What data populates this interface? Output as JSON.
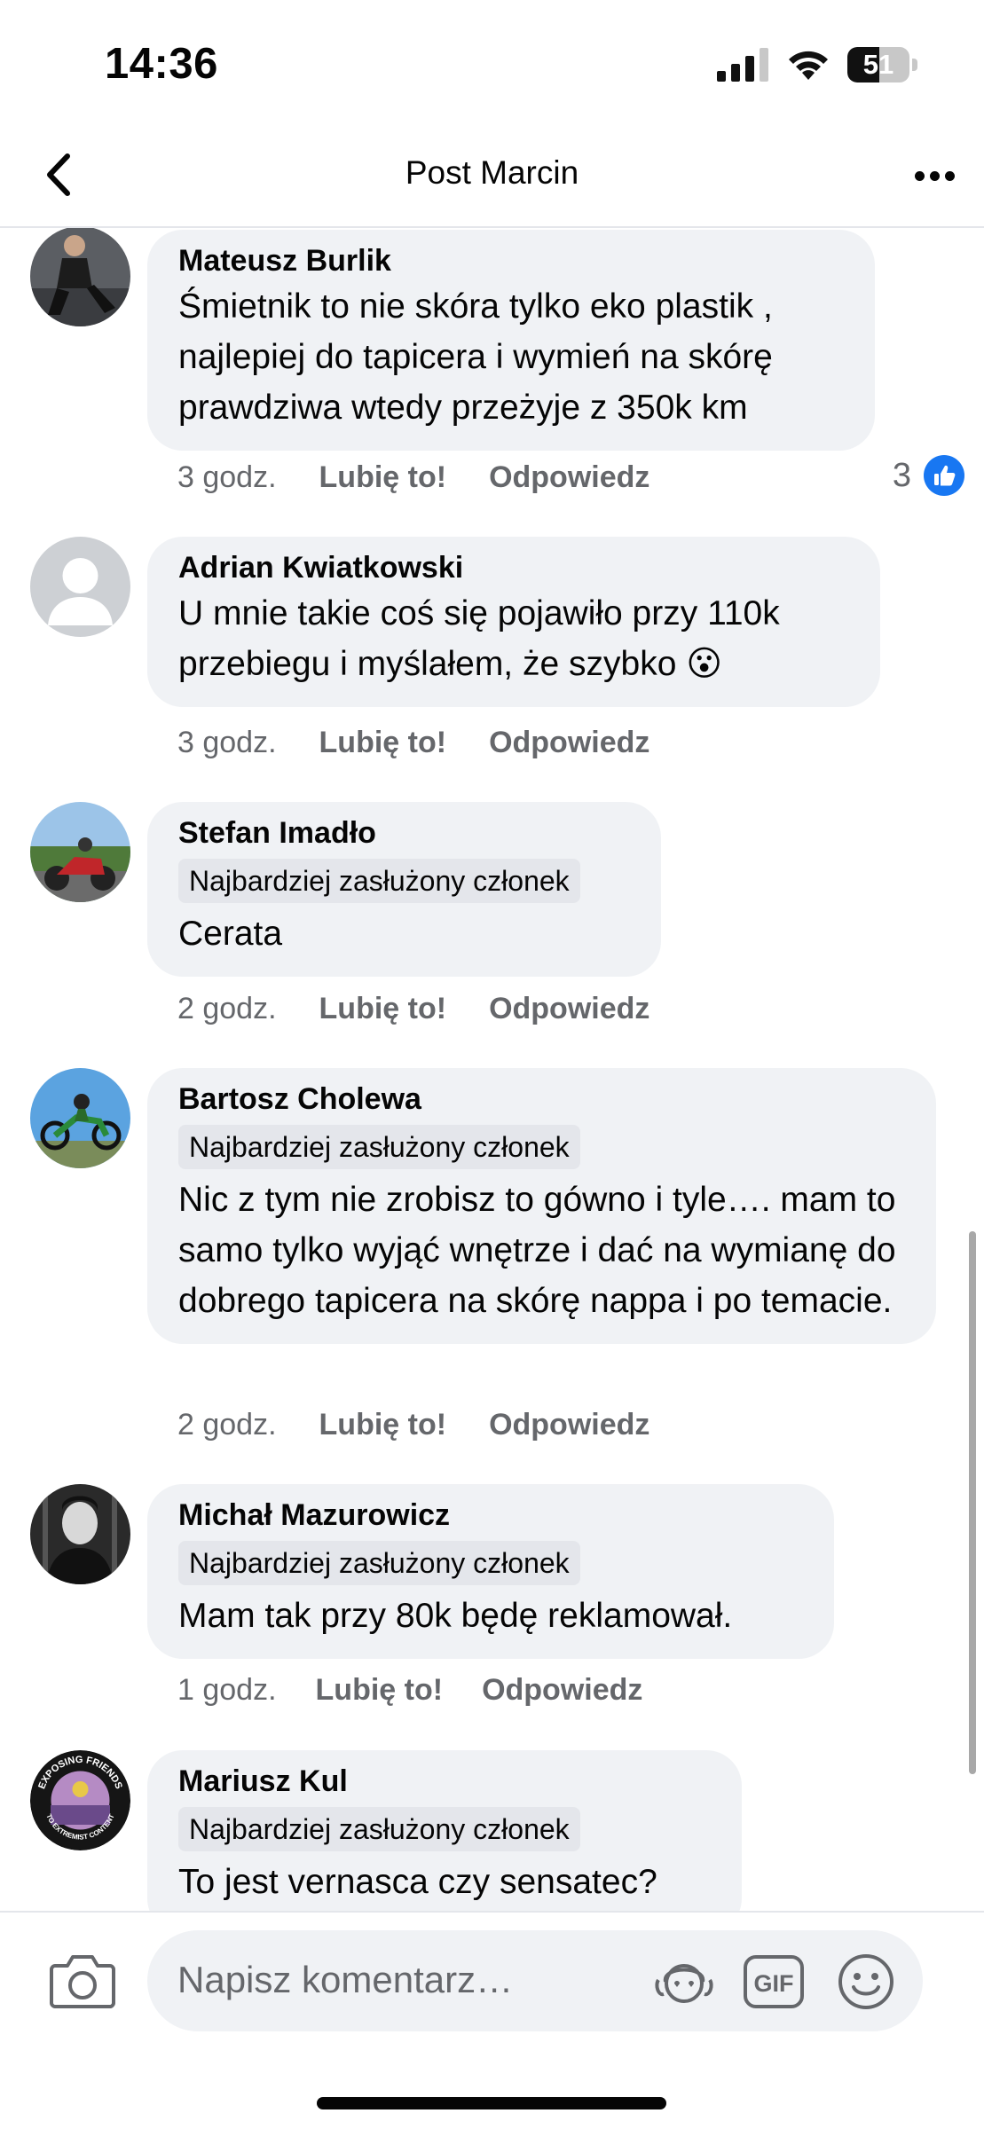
{
  "status_bar": {
    "time": "14:36",
    "battery_level": "51",
    "battery_fraction": 0.51,
    "icons": [
      "cellular-signal-icon",
      "wifi-icon",
      "battery-icon"
    ]
  },
  "header": {
    "title": "Post Marcin",
    "back_icon": "chevron-left-icon",
    "more_icon": "more-dots-icon"
  },
  "comments": [
    {
      "author": "Mateusz Burlik",
      "badge": "",
      "text": "Śmietnik to nie skóra tylko eko plastik , najlepiej do tapicera i wymień na skórę prawdziwa wtedy przeżyje z 350k km",
      "time": "3 godz.",
      "like_label": "Lubię to!",
      "reply_label": "Odpowiedz",
      "reaction_count": "3"
    },
    {
      "author": "Adrian Kwiatkowski",
      "badge": "",
      "text": "U mnie takie coś się pojawiło przy 110k przebiegu i myślałem, że szybko 😮",
      "time": "3 godz.",
      "like_label": "Lubię to!",
      "reply_label": "Odpowiedz"
    },
    {
      "author": "Stefan Imadło",
      "badge": "Najbardziej zasłużony członek",
      "text": "Cerata",
      "time": "2 godz.",
      "like_label": "Lubię to!",
      "reply_label": "Odpowiedz"
    },
    {
      "author": "Bartosz Cholewa",
      "badge": "Najbardziej zasłużony członek",
      "text": "Nic z tym nie zrobisz to gówno i tyle…. mam to samo tylko wyjąć wnętrze i dać na wymianę do dobrego tapicera na skórę nappa i po temacie.",
      "time": "2 godz.",
      "like_label": "Lubię to!",
      "reply_label": "Odpowiedz"
    },
    {
      "author": "Michał Mazurowicz",
      "badge": "Najbardziej zasłużony członek",
      "text": "Mam tak przy 80k będę reklamował.",
      "time": "1 godz.",
      "like_label": "Lubię to!",
      "reply_label": "Odpowiedz"
    },
    {
      "author": "Mariusz Kul",
      "badge": "Najbardziej zasłużony członek",
      "text": "To jest vernasca czy sensatec?",
      "avatar_text_top": "EXPOSING FRIENDS",
      "avatar_text_bottom": "TO EXTREMIST CONTENT"
    }
  ],
  "composer": {
    "placeholder": "Napisz komentarz…",
    "gif_label": "GIF",
    "icons": [
      "camera-icon",
      "avatar-sticker-icon",
      "gif-icon",
      "emoji-icon"
    ]
  },
  "colors": {
    "bubble": "#f0f2f5",
    "secondary_text": "#65676b",
    "like_blue": "#1877f2"
  }
}
